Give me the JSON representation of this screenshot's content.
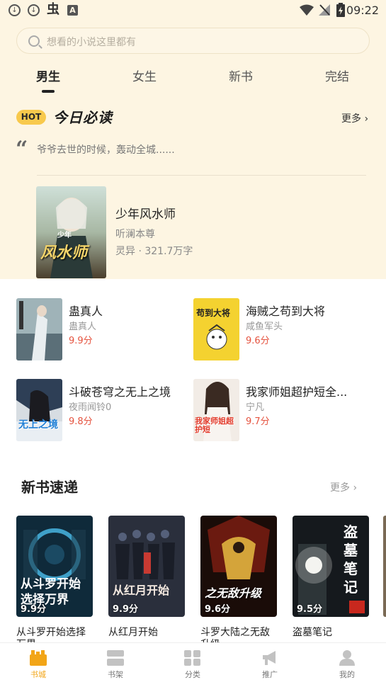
{
  "status_bar": {
    "time": "09:22",
    "bug_glyph": "虫",
    "a_glyph": "A"
  },
  "search": {
    "placeholder": "想看的小说这里都有"
  },
  "tabs": [
    {
      "label": "男生"
    },
    {
      "label": "女生"
    },
    {
      "label": "新书"
    },
    {
      "label": "完结"
    }
  ],
  "today": {
    "badge": "HOT",
    "title": "今日必读",
    "more": "更多",
    "quote_mark": "“",
    "quote": "爷爷去世的时候，轰动全城......",
    "featured": {
      "title": "少年风水师",
      "author": "听澜本尊",
      "meta": "灵异 · 321.7万字",
      "cover_text_top": "少年",
      "cover_text_main": "风水师"
    }
  },
  "recommend": [
    {
      "title": "蛊真人",
      "author": "蛊真人",
      "score": "9.9分"
    },
    {
      "title": "海贼之苟到大将",
      "author": "咸鱼军头",
      "score": "9.6分",
      "cover_text": "苟到大将"
    },
    {
      "title": "斗破苍穹之无上之境",
      "author": "夜雨闻铃0",
      "score": "9.8分",
      "cover_text": "无上之境"
    },
    {
      "title": "我家师姐超护短全...",
      "author": "宁凡",
      "score": "9.7分",
      "cover_text": "我家师姐超护短"
    }
  ],
  "new_books": {
    "title": "新书速递",
    "more": "更多",
    "items": [
      {
        "title": "从斗罗开始选择万界",
        "score": "9.9分",
        "cover_text": "从斗罗开始选择万界"
      },
      {
        "title": "从红月开始",
        "score": "9.9分",
        "cover_text": "从红月开始"
      },
      {
        "title": "斗罗大陆之无敌升级",
        "score": "9.6分",
        "cover_text": "之无敌升级"
      },
      {
        "title": "盗墓笔记",
        "score": "9.5分",
        "cover_text": "盗墓笔记"
      }
    ]
  },
  "bottom_nav": [
    {
      "label": "书城"
    },
    {
      "label": "书架"
    },
    {
      "label": "分类"
    },
    {
      "label": "推广"
    },
    {
      "label": "我的"
    }
  ],
  "colors": {
    "accent": "#f2a517",
    "score": "#e5533f",
    "top_bg": "#fdf5e2"
  }
}
